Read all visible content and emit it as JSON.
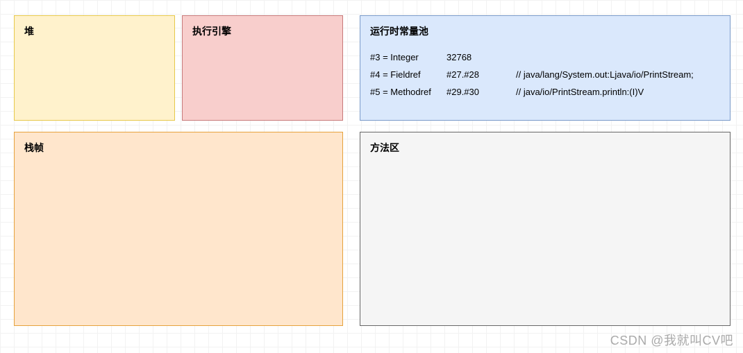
{
  "heap": {
    "title": "堆"
  },
  "engine": {
    "title": "执行引擎"
  },
  "pool": {
    "title": "运行时常量池",
    "rows": [
      {
        "id": "#3 = Integer",
        "ref": "32768",
        "comment": ""
      },
      {
        "id": "#4 = Fieldref",
        "ref": "#27.#28",
        "comment": "// java/lang/System.out:Ljava/io/PrintStream;"
      },
      {
        "id": "#5 = Methodref",
        "ref": "#29.#30",
        "comment": "// java/io/PrintStream.println:(I)V"
      }
    ]
  },
  "frame": {
    "title": "栈帧"
  },
  "method": {
    "title": "方法区"
  },
  "watermark": "CSDN @我就叫CV吧"
}
